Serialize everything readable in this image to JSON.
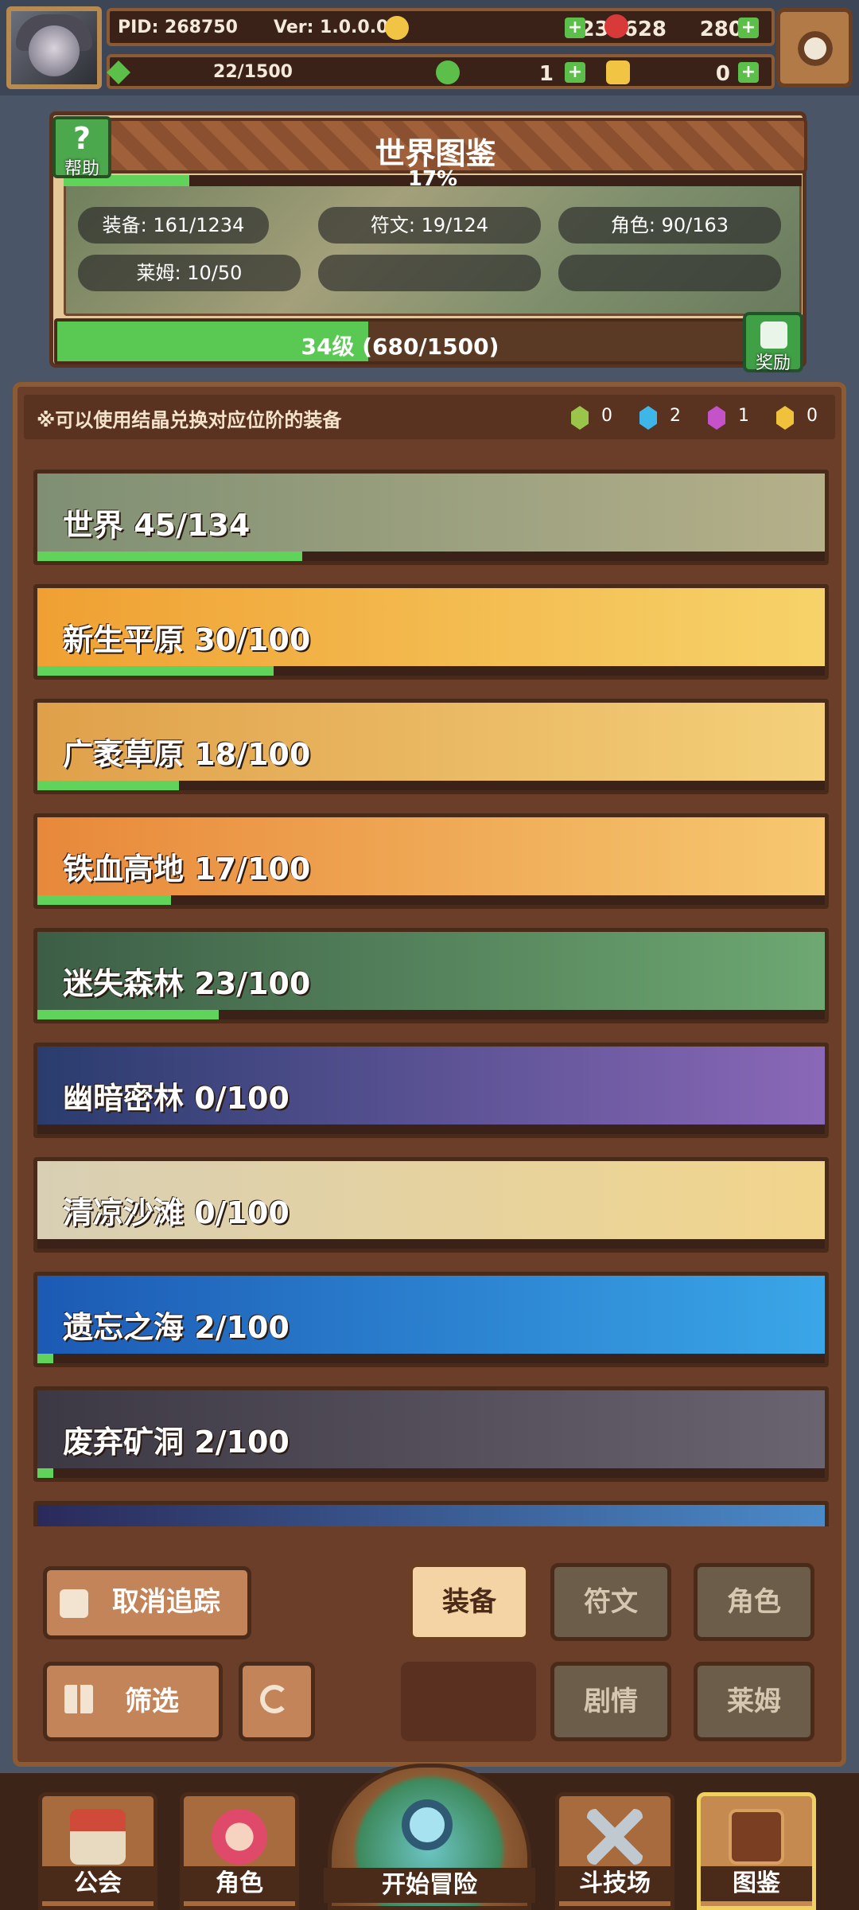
{
  "header": {
    "pid": "PID: 268750",
    "version": "Ver: 1.0.0.0",
    "gold": "231628",
    "gems": "280",
    "energy": "22/1500",
    "clover": "1",
    "keys": "0"
  },
  "codex": {
    "title": "世界图鉴",
    "help_label": "帮助",
    "percent": "17%",
    "percent_value": 0.17,
    "stats": {
      "equipment": "装备: 161/1234",
      "runes": "符文: 19/124",
      "characters": "角色: 90/163",
      "slime": "莱姆: 10/50"
    },
    "level_text": "34级 (680/1500)",
    "level_progress": 0.4533,
    "reward_label": "奖励"
  },
  "notice": {
    "text": "※可以使用结晶兑换对应位阶的装备",
    "crystals": [
      {
        "color": "#9bc54a",
        "count": "0"
      },
      {
        "color": "#3fb6e8",
        "count": "2"
      },
      {
        "color": "#c452c9",
        "count": "1"
      },
      {
        "color": "#f0c13a",
        "count": "0"
      }
    ]
  },
  "regions": [
    {
      "name": "世界  45/134",
      "progress": 0.336,
      "bg1": "#7f8f73",
      "bg2": "#b5b08a"
    },
    {
      "name": "新生平原  30/100",
      "progress": 0.3,
      "bg1": "#f0a032",
      "bg2": "#f6d36a"
    },
    {
      "name": "广袤草原  18/100",
      "progress": 0.18,
      "bg1": "#e0a04a",
      "bg2": "#f4d07a"
    },
    {
      "name": "铁血高地  17/100",
      "progress": 0.17,
      "bg1": "#e8883a",
      "bg2": "#f6c870"
    },
    {
      "name": "迷失森林  23/100",
      "progress": 0.23,
      "bg1": "#3c5e46",
      "bg2": "#6ea872"
    },
    {
      "name": "幽暗密林  0/100",
      "progress": 0.0,
      "bg1": "#2a3c6e",
      "bg2": "#8a68b8"
    },
    {
      "name": "清凉沙滩  0/100",
      "progress": 0.0,
      "bg1": "#d8cfb4",
      "bg2": "#f2d58c"
    },
    {
      "name": "遗忘之海  2/100",
      "progress": 0.02,
      "bg1": "#1c5ab4",
      "bg2": "#3aa6e8"
    },
    {
      "name": "废弃矿洞  2/100",
      "progress": 0.02,
      "bg1": "#3c3844",
      "bg2": "#6a6470"
    },
    {
      "name": "",
      "progress": 0.0,
      "bg1": "#2a2a5a",
      "bg2": "#4a8ac8"
    }
  ],
  "controls": {
    "untrack": "取消追踪",
    "filter": "筛选",
    "tab_equipment": "装备",
    "tab_runes": "符文",
    "tab_characters": "角色",
    "tab_story": "剧情",
    "tab_slime": "莱姆"
  },
  "nav": {
    "guild": "公会",
    "character": "角色",
    "start": "开始冒险",
    "arena": "斗技场",
    "codex": "图鉴"
  }
}
